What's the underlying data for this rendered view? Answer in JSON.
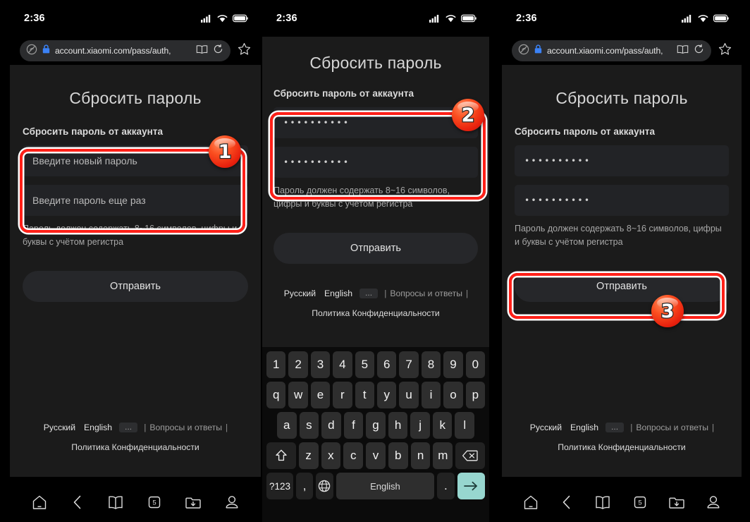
{
  "status_bar": {
    "time": "2:36",
    "signal_icon": "cellular-signal-icon",
    "wifi_icon": "wifi-icon",
    "battery_icon": "battery-icon"
  },
  "browser": {
    "url": "account.xiaomi.com/pass/auth,",
    "shield_icon": "no-tracking-shield-icon",
    "lock_icon": "https-lock-icon",
    "reader_icon": "reader-mode-icon",
    "reload_icon": "reload-icon",
    "bookmark_icon": "bookmark-star-icon"
  },
  "page": {
    "title": "Сбросить пароль",
    "section_label": "Сбросить пароль от аккаунта",
    "password_placeholder": "Введите новый пароль",
    "confirm_placeholder": "Введите пароль еще раз",
    "password_value": "••••••••••",
    "confirm_value": "••••••••••",
    "hint": "Пароль должен содержать 8~16 символов, цифры и буквы с учётом регистра",
    "submit_label": "Отправить"
  },
  "footer": {
    "lang_ru": "Русский",
    "lang_en": "English",
    "more": "...",
    "sep": "|",
    "faq": "Вопросы и ответы",
    "privacy": "Политика Конфиденциальности"
  },
  "nav": {
    "home_icon": "home-icon",
    "back_icon": "back-chevron-icon",
    "bookmarks_icon": "book-icon",
    "tabs_icon": "tabs-count-icon",
    "tabs_count": "5",
    "downloads_icon": "downloads-folder-icon",
    "profile_icon": "profile-account-icon"
  },
  "keyboard": {
    "row_numbers": [
      "1",
      "2",
      "3",
      "4",
      "5",
      "6",
      "7",
      "8",
      "9",
      "0"
    ],
    "row_top": [
      "q",
      "w",
      "e",
      "r",
      "t",
      "y",
      "u",
      "i",
      "o",
      "p"
    ],
    "row_home": [
      "a",
      "s",
      "d",
      "f",
      "g",
      "h",
      "j",
      "k",
      "l"
    ],
    "row_bottom": [
      "z",
      "x",
      "c",
      "v",
      "b",
      "n",
      "m"
    ],
    "shift_icon": "shift-arrow-icon",
    "backspace_icon": "backspace-icon",
    "sym_key": "?123",
    "comma_key": ",",
    "globe_icon": "language-globe-icon",
    "space_label": "English",
    "period_key": ".",
    "enter_icon": "enter-arrow-icon",
    "enter_color": "#97d6cf"
  },
  "annotations": {
    "badge_1": "1",
    "badge_2": "2",
    "badge_3": "3",
    "highlight_color": "#ff2018"
  }
}
